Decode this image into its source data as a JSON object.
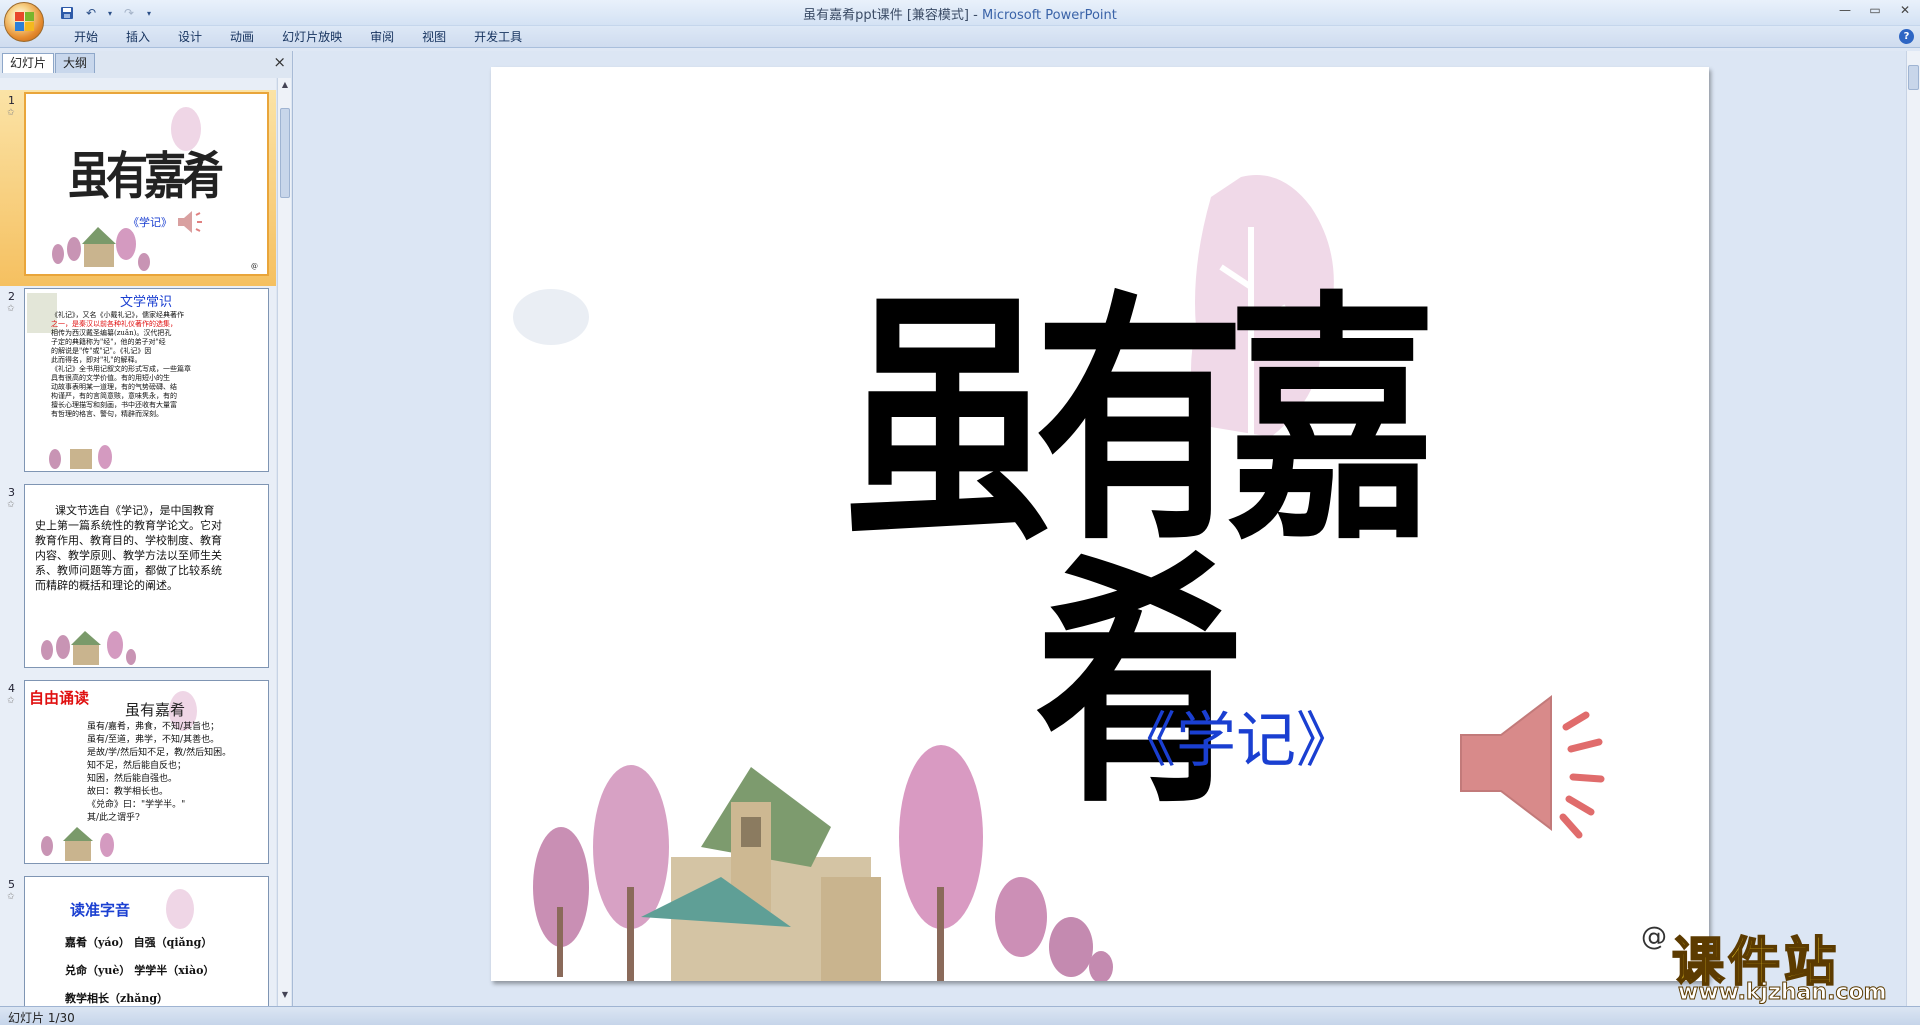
{
  "window": {
    "title": "虽有嘉肴ppt课件 [兼容模式]",
    "app_name": "Microsoft PowerPoint",
    "separator": " - "
  },
  "ribbon": {
    "tabs": [
      "开始",
      "插入",
      "设计",
      "动画",
      "幻灯片放映",
      "审阅",
      "视图",
      "开发工具"
    ]
  },
  "left_panel": {
    "tabs": [
      "幻灯片",
      "大纲"
    ],
    "close_label": "×"
  },
  "thumbnails": [
    {
      "num": "1",
      "title": "虽有嘉肴",
      "subtitle": "《学记》"
    },
    {
      "num": "2",
      "heading": "文学常识",
      "lines": [
        "《礼记》，又名《小戴礼记》，儒家经典著作",
        "之一，是秦汉以前各种礼仪著作的选集，",
        "相传为西汉戴圣编纂(zuǎn)。汉代把孔",
        "子定的典籍称为\"经\"，他的弟子对\"经",
        "的解说是\"传\"或\"记\"。《礼记》因",
        "此而得名，即对\"礼\"的解释。",
        "《礼记》全书用记叙文的形式写成，一些篇章",
        "具有很高的文学价值。有的用短小的生",
        "动故事表明某一道理，有的气势磅礴、结",
        "构谨严，有的言简意赅，意味隽永，有的",
        "擅长心理描写和刻画，书中还收有大量富",
        "有哲理的格言、警句，精辟而深刻。"
      ]
    },
    {
      "num": "3",
      "lines": [
        "课文节选自《学记》，是中国教育",
        "史上第一篇系统性的教育学论文。它对",
        "教育作用、教育目的、学校制度、教育",
        "内容、教学原则、教学方法以至师生关",
        "系、教师问题等方面，都做了比较系统",
        "而精辟的概括和理论的阐述。"
      ]
    },
    {
      "num": "4",
      "label": "自由诵读",
      "heading": "虽有嘉肴",
      "lines": [
        "虽有/嘉肴，弗食，不知/其旨也；",
        "虽有/至道，弗学，不知/其善也。",
        "是故/学/然后知不足，教/然后知困。",
        "知不足，然后能自反也；",
        "知困，然后能自强也。",
        "故曰：教学相长也。",
        "《兑命》曰：\"学学半。\"",
        "其/此之谓乎?"
      ]
    },
    {
      "num": "5",
      "heading": "读准字音",
      "rows": [
        "嘉肴（yáo）   自强（qiǎng）",
        "兑命（yuè）   学学半（xiào）",
        "教学相长（zhǎng）"
      ]
    }
  ],
  "slide": {
    "title": "虽有嘉肴",
    "subtitle": "《学记》",
    "at_mark": "@"
  },
  "watermark": {
    "title": "课件站",
    "url": "www.kjzhan.com"
  },
  "status": {
    "slide_counter": "幻灯片 1/30"
  },
  "colors": {
    "title_black": "#000000",
    "subtitle_blue": "#1a3fd1",
    "selection_orange": "#f5c060",
    "highlight_red": "#e01010",
    "watermark_yellow": "#f4d42a"
  }
}
